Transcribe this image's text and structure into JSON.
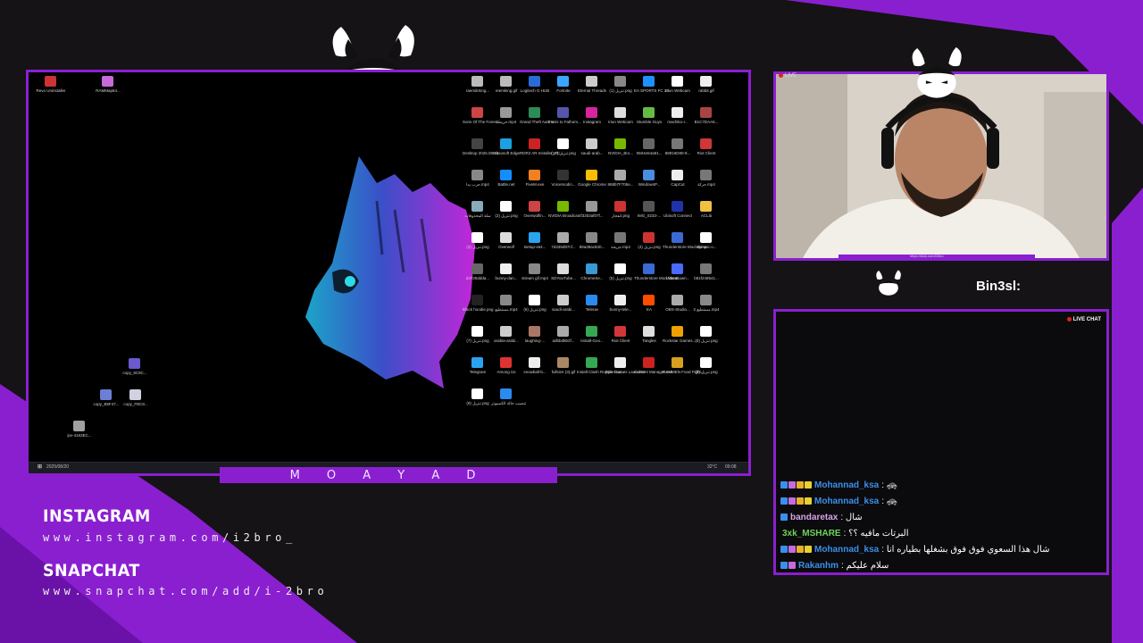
{
  "colors": {
    "accent": "#8a1fd0",
    "background": "#151316"
  },
  "desktop": {
    "left_icons": [
      {
        "label": "Revo Uninstaller",
        "color": "#cc3333"
      },
      {
        "label": "RAMMap64...",
        "color": "#c86adb"
      }
    ],
    "scatter_icons": [
      {
        "label": "copy_9C9C...",
        "color": "#6a5acd"
      },
      {
        "label": "copy_B5F47...",
        "color": "#6d7fd3"
      },
      {
        "label": "copy_FBC8...",
        "color": "#d1d1e0"
      },
      {
        "label": "ipv-4163EC...",
        "color": "#a0a0a0"
      }
    ],
    "grid_icons": [
      {
        "label": "raemikSing...",
        "color": "#bbb"
      },
      {
        "label": "reemking.gif",
        "color": "#bbb"
      },
      {
        "label": "Logitech G HUB",
        "color": "#2a6bd8"
      },
      {
        "label": "Fortnite",
        "color": "#3aa6ff"
      },
      {
        "label": "Eternal Threads",
        "color": "#ccc"
      },
      {
        "label": "تنزيل (1).png",
        "color": "#888"
      },
      {
        "label": "EA SPORTS FC 26",
        "color": "#1e90ff"
      },
      {
        "label": "Iriun Webcam",
        "color": "#fff"
      },
      {
        "label": "rabbit.gif",
        "color": "#eee"
      },
      {
        "label": "Sons Of The Forest",
        "color": "#c44"
      },
      {
        "label": "خريطة.mp4",
        "color": "#999"
      },
      {
        "label": "Grand Theft Auto V",
        "color": "#2e8b57"
      },
      {
        "label": "Fears to Fathom...",
        "color": "#5555aa"
      },
      {
        "label": "Instagram",
        "color": "#d6249f"
      },
      {
        "label": "Iriun Webcam",
        "color": "#ddd"
      },
      {
        "label": "Stumble Guys",
        "color": "#66bb44"
      },
      {
        "label": "machiko-r...",
        "color": "#eee"
      },
      {
        "label": "B1C7DAA5...",
        "color": "#aa4444"
      },
      {
        "label": "Desktop 2025.08.20...",
        "color": "#444"
      },
      {
        "label": "Microsoft Edge",
        "color": "#1ba1e2"
      },
      {
        "label": "RDR2 AR Installer_PC...",
        "color": "#cc2222"
      },
      {
        "label": "تنزيل (10).png",
        "color": "#fff"
      },
      {
        "label": "saudi-arab...",
        "color": "#ccc"
      },
      {
        "label": "NVIDIA_Bro...",
        "color": "#76b900"
      },
      {
        "label": "0604e54a81...",
        "color": "#666"
      },
      {
        "label": "88916D80-8...",
        "color": "#777"
      },
      {
        "label": "Riot Client",
        "color": "#d13639"
      },
      {
        "label": "حرب يدا.mp4",
        "color": "#888"
      },
      {
        "label": "Battle.net",
        "color": "#148eff"
      },
      {
        "label": "FiveM.exe",
        "color": "#f08020"
      },
      {
        "label": "Voicemodin...",
        "color": "#333"
      },
      {
        "label": "Google Chrome",
        "color": "#fbbc05"
      },
      {
        "label": "868b7F705e...",
        "color": "#aaa"
      },
      {
        "label": "WindowsP...",
        "color": "#4a8ce0"
      },
      {
        "label": "CapCut",
        "color": "#eee"
      },
      {
        "label": "حركة.mp4",
        "color": "#777"
      },
      {
        "label": "سلة المحذوفات",
        "color": "#8ab"
      },
      {
        "label": "تنزيل (2).png",
        "color": "#fff"
      },
      {
        "label": "Overwolfin...",
        "color": "#cc4444"
      },
      {
        "label": "NVIDIA Broadcast",
        "color": "#76b900"
      },
      {
        "label": "f3253af07f...",
        "color": "#999"
      },
      {
        "label": "انفجار.png",
        "color": "#c33"
      },
      {
        "label": "IMG_0233-...",
        "color": "#555"
      },
      {
        "label": "Ubisoft Connect",
        "color": "#2233aa"
      },
      {
        "label": "ACLib",
        "color": "#f0c040"
      },
      {
        "label": "تنزيل (3).png",
        "color": "#fff"
      },
      {
        "label": "Overwolf",
        "color": "#ddd"
      },
      {
        "label": "tsetup-x64...",
        "color": "#2aa3ef"
      },
      {
        "label": "7d435d97cf...",
        "color": "#aaa"
      },
      {
        "label": "88a38ac840...",
        "color": "#888"
      },
      {
        "label": "جريحة.mp4",
        "color": "#777"
      },
      {
        "label": "تنزيل (4).png",
        "color": "#c33"
      },
      {
        "label": "Thunderstore Mod Mana...",
        "color": "#3a6ad4"
      },
      {
        "label": "olympic-o...",
        "color": "#fff"
      },
      {
        "label": "d4725ddda...",
        "color": "#666"
      },
      {
        "label": "bunny-dan...",
        "color": "#eee"
      },
      {
        "label": "stream gif.mp4",
        "color": "#888"
      },
      {
        "label": "SDYouTube...",
        "color": "#ddd"
      },
      {
        "label": "ChromeSe...",
        "color": "#3a9ad4"
      },
      {
        "label": "تنزيل (5).png",
        "color": "#fff"
      },
      {
        "label": "Thunderstore Mod Mana...",
        "color": "#3a6ad4"
      },
      {
        "label": "VideoDown...",
        "color": "#4a6aff"
      },
      {
        "label": "b81f248541...",
        "color": "#777"
      },
      {
        "label": "Black hoodie.png",
        "color": "#222"
      },
      {
        "label": "مستطيع.mp4",
        "color": "#888"
      },
      {
        "label": "تنزيل (6).png",
        "color": "#fff"
      },
      {
        "label": "saudi-arabi...",
        "color": "#ccc"
      },
      {
        "label": "Telerav",
        "color": "#2a8aef"
      },
      {
        "label": "bunny-tele...",
        "color": "#eee"
      },
      {
        "label": "EA",
        "color": "#ff4d00"
      },
      {
        "label": "OBS-Studio...",
        "color": "#aaa"
      },
      {
        "label": "مستطيع 2.mp4",
        "color": "#888"
      },
      {
        "label": "تنزيل (7).png",
        "color": "#fff"
      },
      {
        "label": "arabia-arabi...",
        "color": "#ccc"
      },
      {
        "label": "laughing-...",
        "color": "#aa7766"
      },
      {
        "label": "adbbd8b2f...",
        "color": "#aaa"
      },
      {
        "label": "Install-Goo...",
        "color": "#34a853"
      },
      {
        "label": "Riot Client",
        "color": "#d13639"
      },
      {
        "label": "Tangles",
        "color": "#ddd"
      },
      {
        "label": "Rockstar Games...",
        "color": "#f0a000"
      },
      {
        "label": "تنزيل (8).png",
        "color": "#fff"
      },
      {
        "label": "Telegram",
        "color": "#2aa3ef"
      },
      {
        "label": "Among Us",
        "color": "#d33"
      },
      {
        "label": "snowball-b...",
        "color": "#eee"
      },
      {
        "label": "fullsize (3).gif",
        "color": "#aa8866"
      },
      {
        "label": "Install-Clash Royale-Goo...",
        "color": "#34a853"
      },
      {
        "label": "Epic Games Launcher",
        "color": "#eee"
      },
      {
        "label": "Content Manager.exe",
        "color": "#cc2222"
      },
      {
        "label": "RAMMEN Food Fight...",
        "color": "#d5a020"
      },
      {
        "label": "تنزيل (9).png",
        "color": "#fff"
      },
      {
        "label": "تنزيل (9).png",
        "color": "#fff"
      },
      {
        "label": "تنصيب حالة الكمبيوتر",
        "color": "#2a8aef"
      }
    ],
    "taskbar": {
      "time": "09:08",
      "date": "2025/08/20",
      "weather": "32°C",
      "weather_desc": "غالب مشمس"
    }
  },
  "name_bar": {
    "text": "M O A Y A D"
  },
  "social": {
    "instagram_title": "INSTAGRAM",
    "instagram_url": "www.instagram.com/i2bro_",
    "snapchat_title": "SNAPCHAT",
    "snapchat_url": "www.snapchat.com/add/i-2bro"
  },
  "webcam": {
    "live_label": "LIVE",
    "url_text": "https://kick.com/i2bro"
  },
  "handle": {
    "text": "Bin3sl:"
  },
  "chat": {
    "live_label": "LIVE CHAT",
    "messages": [
      {
        "user": "Mohannad_ksa",
        "user_color": "#3c8fe8",
        "text": ": 🚓"
      },
      {
        "user": "Mohannad_ksa",
        "user_color": "#3c8fe8",
        "text": ": 🚓"
      },
      {
        "user": "bandaretax",
        "user_color": "#d8a2e8",
        "text": ": شال"
      },
      {
        "user": "3xk_MSHARE",
        "user_color": "#6fd35a",
        "text": ": البرتات مافيه ؟؟"
      },
      {
        "user": "Mohannad_ksa",
        "user_color": "#3c8fe8",
        "text": ": شال هذا السعوي فوق فوق بشغلها بطياره انا"
      },
      {
        "user": "Rakanhm",
        "user_color": "#3c8fe8",
        "text": ": سلام عليكم"
      }
    ]
  }
}
